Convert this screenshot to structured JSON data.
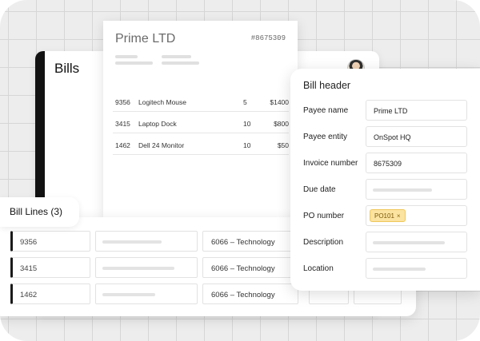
{
  "bills": {
    "title": "Bills"
  },
  "invoice": {
    "payee": "Prime LTD",
    "number": "#8675309",
    "rows": [
      {
        "code": "9356",
        "item": "Logitech Mouse",
        "qty": "5",
        "amount": "$1400"
      },
      {
        "code": "3415",
        "item": "Laptop Dock",
        "qty": "10",
        "amount": "$800"
      },
      {
        "code": "1462",
        "item": "Dell 24 Monitor",
        "qty": "10",
        "amount": "$50"
      }
    ]
  },
  "bill_header": {
    "title": "Bill header",
    "fields": [
      {
        "label": "Payee name",
        "value": "Prime LTD"
      },
      {
        "label": "Payee entity",
        "value": "OnSpot HQ"
      },
      {
        "label": "Invoice number",
        "value": "8675309"
      },
      {
        "label": "Due date",
        "value": ""
      },
      {
        "label": "PO number",
        "chip": "PO101",
        "chip_remove": "×"
      },
      {
        "label": "Description",
        "value": ""
      },
      {
        "label": "Location",
        "value": ""
      }
    ]
  },
  "bill_lines": {
    "title": "Bill Lines (3)",
    "rows": [
      {
        "code": "9356",
        "category": "6066 – Technology"
      },
      {
        "code": "3415",
        "category": "6066 – Technology"
      },
      {
        "code": "1462",
        "category": "6066 – Technology"
      }
    ]
  }
}
